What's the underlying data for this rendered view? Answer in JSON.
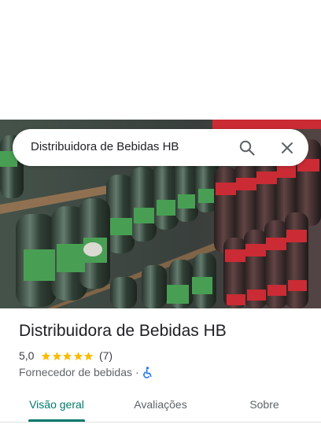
{
  "search": {
    "query": "Distribuidora de Bebidas HB",
    "search_icon": "search-icon",
    "clear_icon": "close-icon"
  },
  "photo": {
    "description_icon": "place-photo"
  },
  "place": {
    "name": "Distribuidora de Bebidas HB",
    "rating": "5,0",
    "rating_value": 5.0,
    "stars_filled": 5,
    "review_count": "(7)",
    "category": "Fornecedor de bebidas",
    "separator": "·",
    "accessibility_icon": "wheelchair-icon"
  },
  "tabs": [
    {
      "label": "Visão geral",
      "active": true
    },
    {
      "label": "Avaliações",
      "active": false
    },
    {
      "label": "Sobre",
      "active": false
    }
  ],
  "colors": {
    "accent": "#00796b",
    "star": "#fbbc04",
    "accessibility": "#1a73e8"
  }
}
